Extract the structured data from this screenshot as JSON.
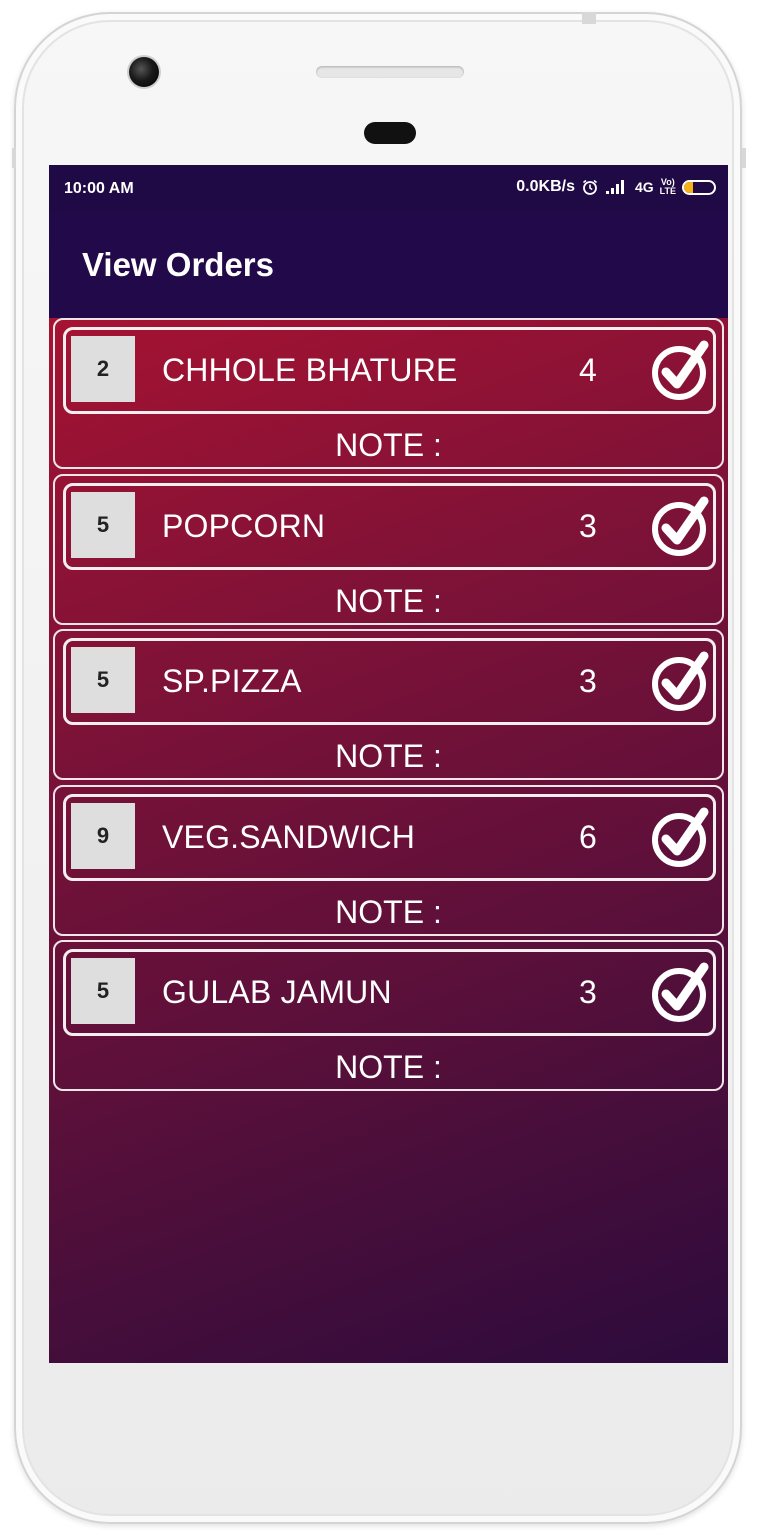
{
  "status_bar": {
    "time": "10:00 AM",
    "network_speed": "0.0KB/s",
    "network_type": "4G",
    "volte_top": "Vo)",
    "volte_bottom": "LTE",
    "battery_level": "29",
    "battery_fraction": 0.29,
    "icons": [
      "alarm-icon",
      "signal-icon",
      "battery-icon"
    ]
  },
  "app_bar": {
    "title": "View Orders"
  },
  "colors": {
    "status_bar_bg": "#1f0a45",
    "app_bar_bg": "#220949",
    "gradient_start": "#b5132f",
    "gradient_end": "#2c0b3c",
    "table_box_bg": "#dedede",
    "battery_accent": "#f5b21b"
  },
  "orders": [
    {
      "table_no": "2",
      "item": "CHHOLE BHATURE",
      "quantity": "4",
      "note_label": "NOTE :",
      "icon": "check-circle-icon"
    },
    {
      "table_no": "5",
      "item": "POPCORN",
      "quantity": "3",
      "note_label": "NOTE :",
      "icon": "check-circle-icon"
    },
    {
      "table_no": "5",
      "item": "SP.PIZZA",
      "quantity": "3",
      "note_label": "NOTE :",
      "icon": "check-circle-icon"
    },
    {
      "table_no": "9",
      "item": "VEG.SANDWICH",
      "quantity": "6",
      "note_label": "NOTE :",
      "icon": "check-circle-icon"
    },
    {
      "table_no": "5",
      "item": "GULAB JAMUN",
      "quantity": "3",
      "note_label": "NOTE :",
      "icon": "check-circle-icon"
    }
  ]
}
